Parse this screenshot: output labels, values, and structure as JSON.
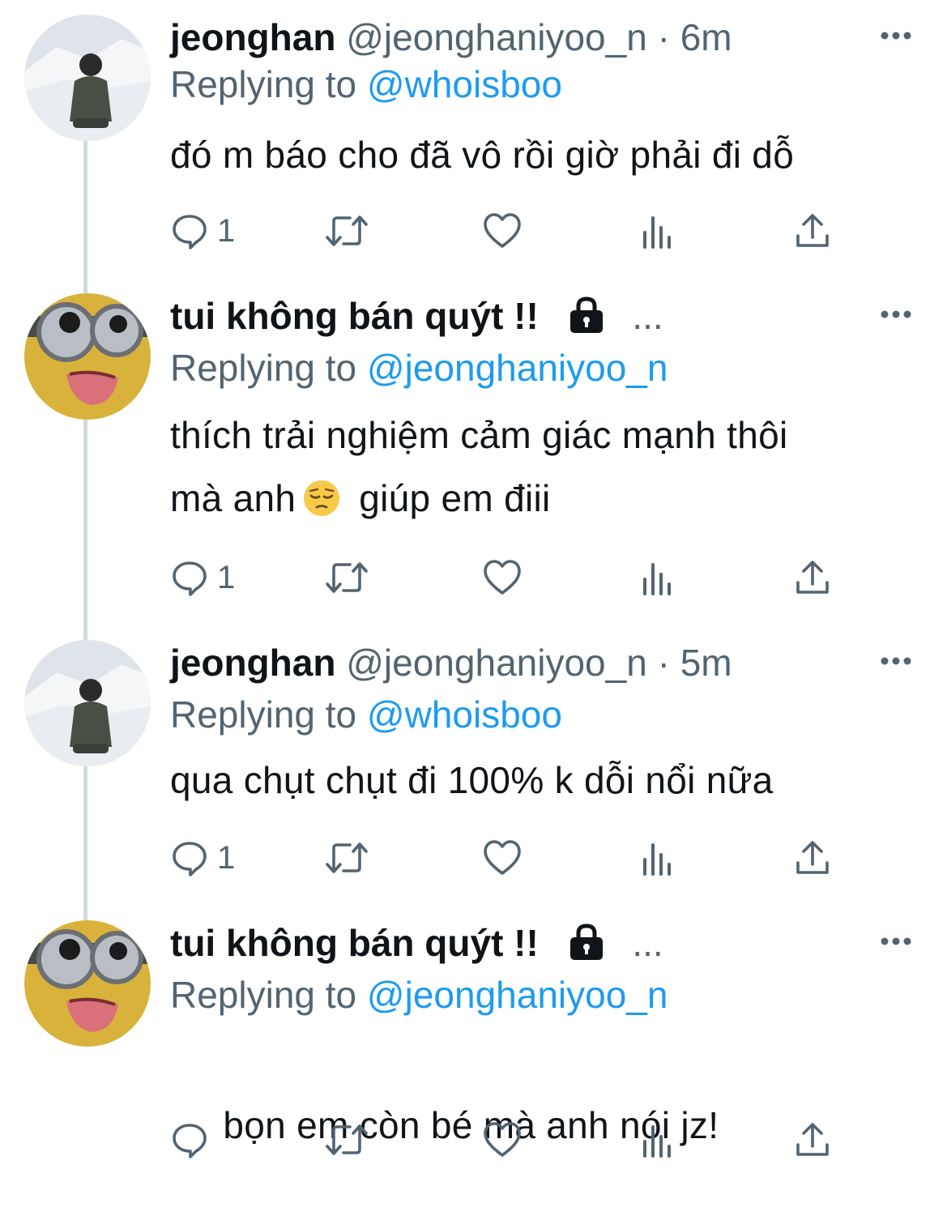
{
  "tweets": [
    {
      "name": "jeonghan",
      "handle": "@jeonghaniyoo_n",
      "separator": "·",
      "time": "6m",
      "replying_label": "Replying to",
      "replying_to": "@whoisboo",
      "text_line1": "đó m báo cho đã vô rồi giờ phải đi dỗ",
      "reply_count": "1"
    },
    {
      "name": "tui không bán quýt !!",
      "protected": true,
      "truncation": "...",
      "replying_label": "Replying to",
      "replying_to": "@jeonghaniyoo_n",
      "text_line1": "thích trải nghiệm cảm giác mạnh thôi",
      "text_line2_a": "mà anh",
      "text_line2_b": "giúp em điii",
      "emoji": "pensive-face",
      "reply_count": "1"
    },
    {
      "name": "jeonghan",
      "handle": "@jeonghaniyoo_n",
      "separator": "·",
      "time": "5m",
      "replying_label": "Replying to",
      "replying_to": "@whoisboo",
      "text_line1": "qua chụt chụt đi 100% k dỗi nổi nữa",
      "reply_count": "1"
    },
    {
      "name": "tui không bán quýt !!",
      "protected": true,
      "truncation": "...",
      "replying_label": "Replying to",
      "replying_to": "@jeonghaniyoo_n",
      "text_line1": " bọn em còn bé mà anh nói jz!",
      "reply_count": ""
    }
  ],
  "icons": [
    "more-icon",
    "reply-icon",
    "retweet-icon",
    "like-icon",
    "analytics-icon",
    "share-icon",
    "lock-icon"
  ],
  "colors": {
    "text": "#0f1419",
    "secondary": "#536471",
    "mention": "#1d9bf0",
    "thread_line": "#cfd9de"
  }
}
